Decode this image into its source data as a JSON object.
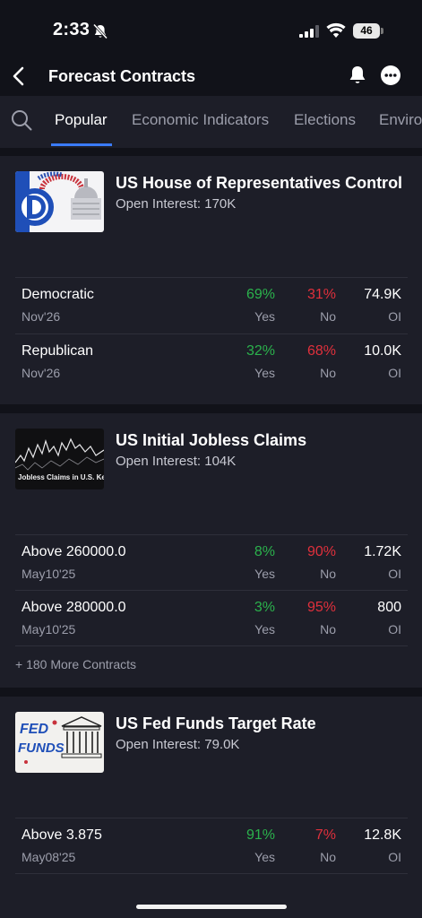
{
  "status": {
    "time": "2:33",
    "battery": "46"
  },
  "nav": {
    "title": "Forecast Contracts"
  },
  "tabs": [
    {
      "label": "Popular"
    },
    {
      "label": "Economic Indicators"
    },
    {
      "label": "Elections"
    },
    {
      "label": "Enviro"
    }
  ],
  "colors": {
    "yes": "#2bb24c",
    "no": "#e0303c",
    "accent": "#3a7bfa",
    "card_bg": "#1d1e28",
    "page_bg": "#111219"
  },
  "markets": [
    {
      "title": "US House of Representatives Control",
      "open_interest": "Open Interest: 170K",
      "contracts": [
        {
          "name": "Democratic",
          "date": "Nov'26",
          "yes_pct": "69%",
          "yes_label": "Yes",
          "no_pct": "31%",
          "no_label": "No",
          "oi": "74.9K",
          "oi_label": "OI"
        },
        {
          "name": "Republican",
          "date": "Nov'26",
          "yes_pct": "32%",
          "yes_label": "Yes",
          "no_pct": "68%",
          "no_label": "No",
          "oi": "10.0K",
          "oi_label": "OI"
        }
      ]
    },
    {
      "title": "US Initial Jobless Claims",
      "open_interest": "Open Interest: 104K",
      "thumb_text": "Jobless Claims in U.S. Ke",
      "contracts": [
        {
          "name": "Above 260000.0",
          "date": "May10'25",
          "yes_pct": "8%",
          "yes_label": "Yes",
          "no_pct": "90%",
          "no_label": "No",
          "oi": "1.72K",
          "oi_label": "OI"
        },
        {
          "name": "Above 280000.0",
          "date": "May10'25",
          "yes_pct": "3%",
          "yes_label": "Yes",
          "no_pct": "95%",
          "no_label": "No",
          "oi": "800",
          "oi_label": "OI"
        }
      ],
      "more": "+ 180 More Contracts"
    },
    {
      "title": "US Fed Funds Target Rate",
      "open_interest": "Open Interest: 79.0K",
      "thumb_text_1": "FED",
      "thumb_text_2": "FUNDS",
      "contracts": [
        {
          "name": "Above 3.875",
          "date": "May08'25",
          "yes_pct": "91%",
          "yes_label": "Yes",
          "no_pct": "7%",
          "no_label": "No",
          "oi": "12.8K",
          "oi_label": "OI"
        }
      ]
    }
  ]
}
